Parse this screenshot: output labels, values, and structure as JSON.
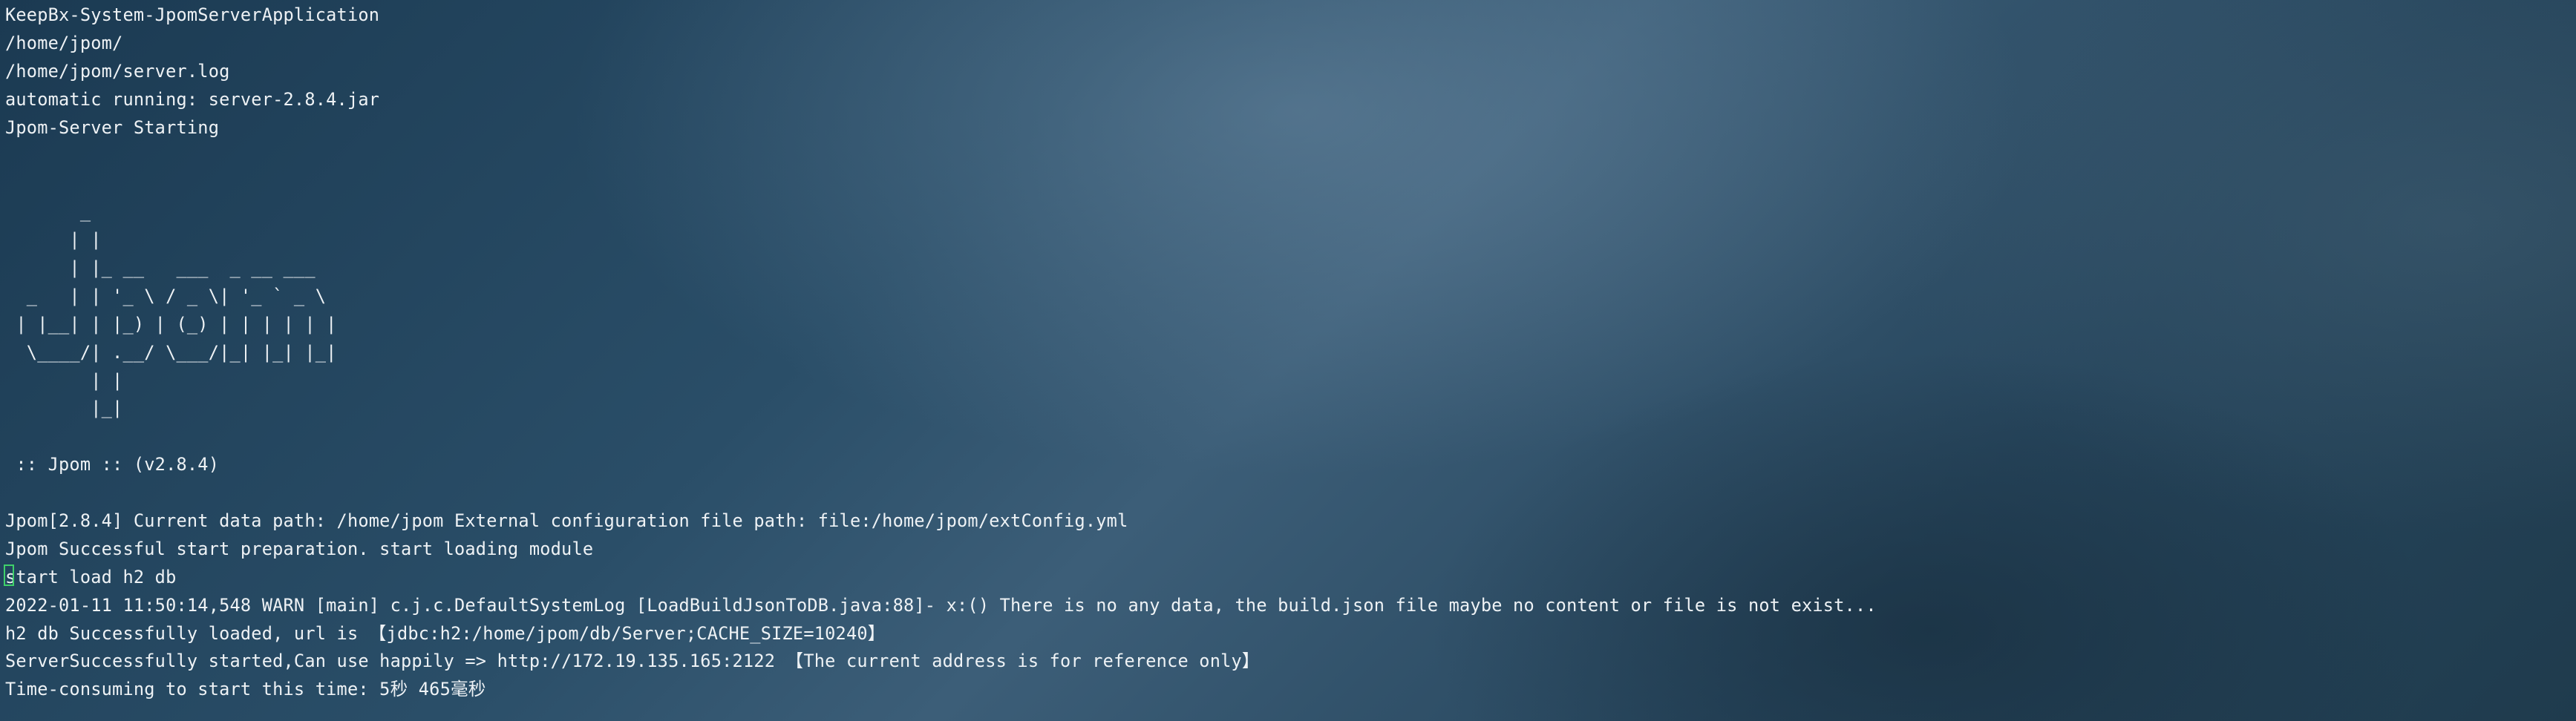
{
  "terminal": {
    "lines": [
      "KeepBx-System-JpomServerApplication",
      "/home/jpom/",
      "/home/jpom/server.log",
      "automatic running: server-2.8.4.jar",
      "Jpom-Server Starting",
      "",
      "",
      "       _",
      "      | |",
      "      | |_ __   ___  _ __ ___",
      "  _   | | '_ \\ / _ \\| '_ ` _ \\",
      " | |__| | |_) | (_) | | | | | |",
      "  \\____/| .__/ \\___/|_| |_| |_|",
      "        | |",
      "        |_|",
      "",
      " :: Jpom :: (v2.8.4)",
      "",
      "Jpom[2.8.4] Current data path: /home/jpom External configuration file path: file:/home/jpom/extConfig.yml",
      "Jpom Successful start preparation. start loading module",
      "start load h2 db",
      "2022-01-11 11:50:14,548 WARN [main] c.j.c.DefaultSystemLog [LoadBuildJsonToDB.java:88]- x:() There is no any data, the build.json file maybe no content or file is not exist...",
      "h2 db Successfully loaded, url is 【jdbc:h2:/home/jpom/db/Server;CACHE_SIZE=10240】",
      "ServerSuccessfully started,Can use happily => http://172.19.135.165:2122 【The current address is for reference only】",
      "Time-consuming to start this time: 5秒 465毫秒"
    ],
    "cursor_line_index": 20
  }
}
